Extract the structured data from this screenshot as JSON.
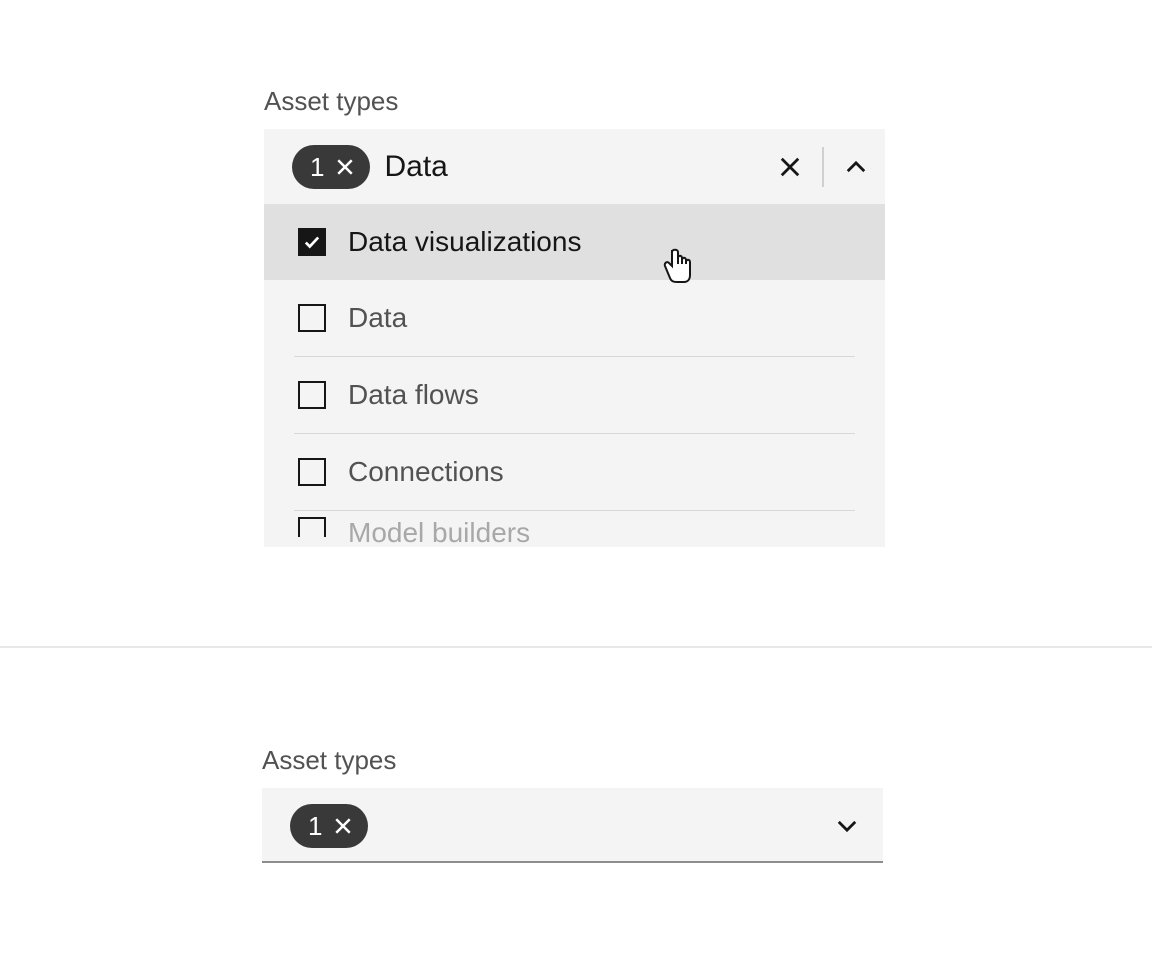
{
  "combo_open": {
    "label": "Asset types",
    "tag_count": "1",
    "search_value": "Data",
    "options": [
      {
        "label": "Data visualizations",
        "checked": true,
        "hover": true
      },
      {
        "label": "Data",
        "checked": false,
        "hover": false
      },
      {
        "label": "Data flows",
        "checked": false,
        "hover": false
      },
      {
        "label": "Connections",
        "checked": false,
        "hover": false
      },
      {
        "label": "Model builders",
        "checked": false,
        "hover": false
      }
    ]
  },
  "combo_closed": {
    "label": "Asset types",
    "tag_count": "1"
  }
}
